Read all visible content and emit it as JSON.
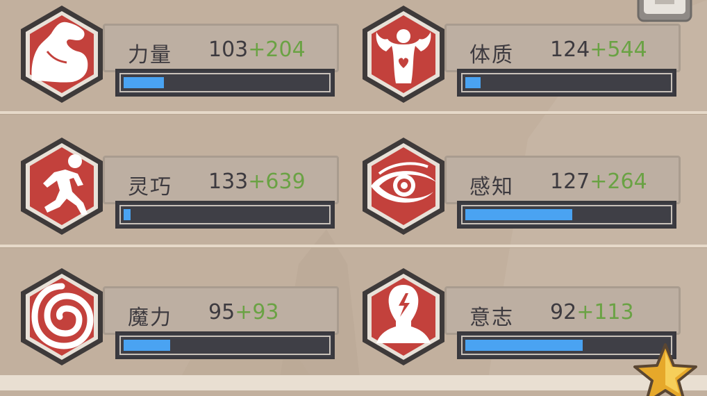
{
  "colors": {
    "bonus": "#6aa244",
    "bar_fill": "#4aa3f2",
    "emblem_red": "#c3413c",
    "emblem_border": "#3e3a3a"
  },
  "stats": [
    {
      "name": "力量",
      "base": "103",
      "bonus": "+204",
      "icon": "flexed-arm-icon",
      "fill": 0.22
    },
    {
      "name": "体质",
      "base": "124",
      "bonus": "+544",
      "icon": "bodybuilder-heart-icon",
      "fill": 0.1
    },
    {
      "name": "灵巧",
      "base": "133",
      "bonus": "+639",
      "icon": "running-man-icon",
      "fill": 0.06
    },
    {
      "name": "感知",
      "base": "127",
      "bonus": "+264",
      "icon": "eye-icon",
      "fill": 0.54
    },
    {
      "name": "魔力",
      "base": "95",
      "bonus": "+93",
      "icon": "spiral-icon",
      "fill": 0.25
    },
    {
      "name": "意志",
      "base": "92",
      "bonus": "+113",
      "icon": "head-lightning-icon",
      "fill": 0.59
    }
  ]
}
